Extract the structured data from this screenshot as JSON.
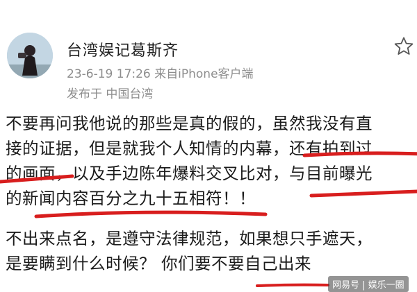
{
  "post": {
    "username": "台湾娱记葛斯齐",
    "meta": "23-6-19 17:26  来自iPhone客户端",
    "location": "发布于  中国台湾",
    "paragraph1": [
      "不要再问我他说的那些是真的假的，虽然我没有直",
      "接的证据，但是就我个人知情的内幕，还有拍到过",
      "的画面，以及手边陈年爆料交叉比对，与目前曝光",
      "的新闻内容百分之九十五相符！！"
    ],
    "paragraph2": [
      "不出来点名，是遵守法律规范，如果想只手遮天，",
      "是要瞒到什么时候？  你们要不要自己出来"
    ]
  },
  "icons": {
    "favorite": "star-outline-icon"
  },
  "colors": {
    "underline": "#d81e1e",
    "secondary_text": "#8d8d8d"
  },
  "watermark": "网易号 | 娱乐一圈"
}
